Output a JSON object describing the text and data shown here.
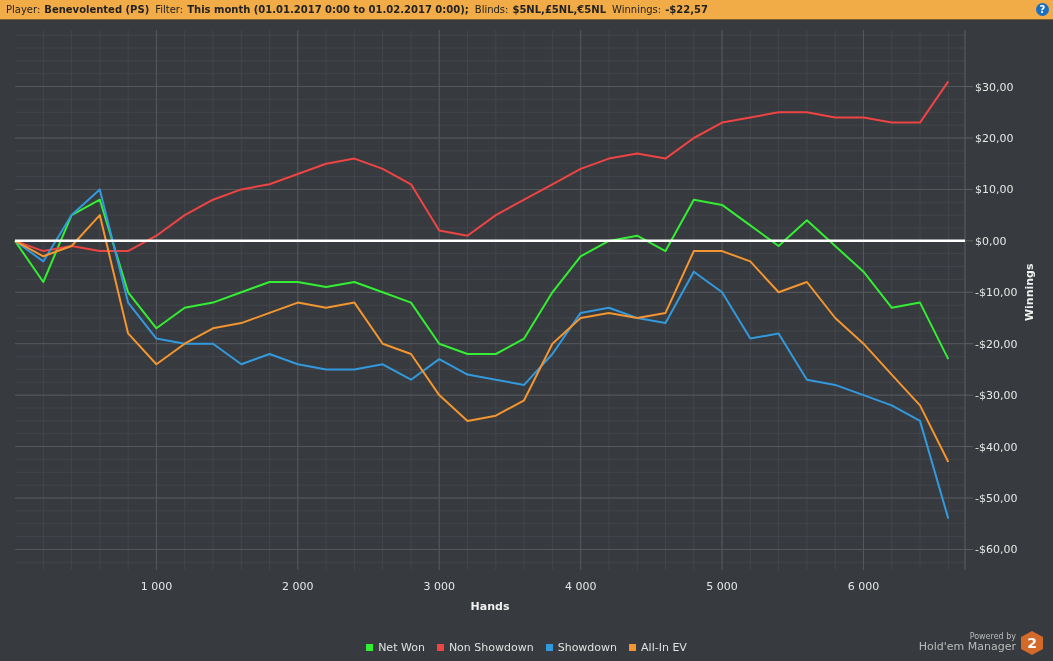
{
  "header": {
    "items": [
      {
        "label": "Player:",
        "value": "Benevolented (PS)"
      },
      {
        "label": "Filter:",
        "value": "This month (01.01.2017 0:00 to 01.02.2017 0:00);"
      },
      {
        "label": "Blinds:",
        "value": "$5NL,£5NL,€5NL"
      },
      {
        "label": "Winnings:",
        "value": "-$22,57"
      }
    ],
    "help": "?"
  },
  "chart": {
    "chart_data": {
      "type": "line",
      "grid": true,
      "xlabel": "Hands",
      "ylabel": "Winnings",
      "x": [
        0,
        200,
        400,
        600,
        800,
        1000,
        1200,
        1400,
        1600,
        1800,
        2000,
        2200,
        2400,
        2600,
        2800,
        3000,
        3200,
        3400,
        3600,
        3800,
        4000,
        4200,
        4400,
        4600,
        4800,
        5000,
        5200,
        5400,
        5600,
        5800,
        6000,
        6200,
        6400,
        6600
      ],
      "series": [
        {
          "name": "Net Won",
          "color": "#33ee33",
          "values": [
            0,
            -8,
            5,
            8,
            -10,
            -17,
            -13,
            -12,
            -10,
            -8,
            -8,
            -9,
            -8,
            -10,
            -12,
            -20,
            -22,
            -22,
            -19,
            -10,
            -3,
            0,
            1,
            -2,
            8,
            7,
            3,
            -1,
            4,
            -1,
            -6,
            -13,
            -12,
            -23
          ]
        },
        {
          "name": "Non Showdown",
          "color": "#ee4444",
          "values": [
            0,
            -2,
            -1,
            -2,
            -2,
            1,
            5,
            8,
            10,
            11,
            13,
            15,
            16,
            14,
            11,
            2,
            1,
            5,
            8,
            11,
            14,
            16,
            17,
            16,
            20,
            23,
            24,
            25,
            25,
            24,
            24,
            23,
            23,
            31
          ]
        },
        {
          "name": "Showdown",
          "color": "#3399dd",
          "values": [
            0,
            -4,
            5,
            10,
            -12,
            -19,
            -20,
            -20,
            -24,
            -22,
            -24,
            -25,
            -25,
            -24,
            -27,
            -23,
            -26,
            -27,
            -28,
            -22,
            -14,
            -13,
            -15,
            -16,
            -6,
            -10,
            -19,
            -18,
            -27,
            -28,
            -30,
            -32,
            -35,
            -54
          ]
        },
        {
          "name": "All-In EV",
          "color": "#f39530",
          "values": [
            0,
            -3,
            -1,
            5,
            -18,
            -24,
            -20,
            -17,
            -16,
            -14,
            -12,
            -13,
            -12,
            -20,
            -22,
            -30,
            -35,
            -34,
            -31,
            -20,
            -15,
            -14,
            -15,
            -14,
            -2,
            -2,
            -4,
            -10,
            -8,
            -15,
            -20,
            -26,
            -32,
            -43
          ]
        }
      ],
      "xlim": [
        0,
        6718
      ],
      "ylim": [
        -64,
        41
      ],
      "xticks": [
        {
          "value": 1000,
          "label": "1 000"
        },
        {
          "value": 2000,
          "label": "2 000"
        },
        {
          "value": 3000,
          "label": "3 000"
        },
        {
          "value": 4000,
          "label": "4 000"
        },
        {
          "value": 5000,
          "label": "5 000"
        },
        {
          "value": 6000,
          "label": "6 000"
        }
      ],
      "yticks": [
        {
          "value": 30,
          "label": "$30,00"
        },
        {
          "value": 20,
          "label": "$20,00"
        },
        {
          "value": 10,
          "label": "$10,00"
        },
        {
          "value": 0,
          "label": "$0,00"
        },
        {
          "value": -10,
          "label": "-$10,00"
        },
        {
          "value": -20,
          "label": "-$20,00"
        },
        {
          "value": -30,
          "label": "-$30,00"
        },
        {
          "value": -40,
          "label": "-$40,00"
        },
        {
          "value": -50,
          "label": "-$50,00"
        },
        {
          "value": -60,
          "label": "-$60,00"
        }
      ]
    }
  },
  "branding": {
    "powered_by": "Powered by",
    "product": "Hold'em Manager",
    "badge": "2"
  }
}
